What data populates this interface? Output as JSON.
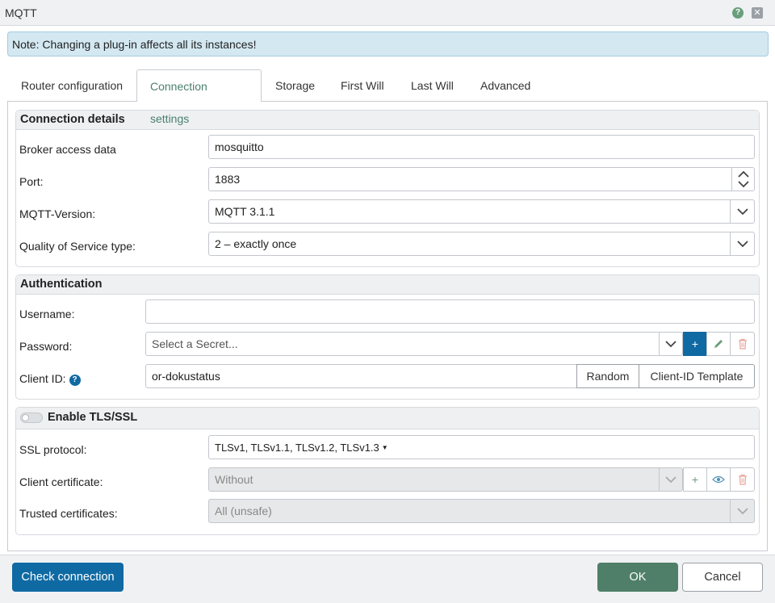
{
  "window": {
    "title": "MQTT",
    "help_icon": "question-icon",
    "close_icon": "close-icon"
  },
  "note": "Note: Changing a plug-in affects all its instances!",
  "tabs": [
    {
      "label": "Router configuration"
    },
    {
      "label": "Connection settings",
      "active": true
    },
    {
      "label": "Storage"
    },
    {
      "label": "First Will"
    },
    {
      "label": "Last Will"
    },
    {
      "label": "Advanced"
    }
  ],
  "connection": {
    "heading": "Connection details",
    "broker_label": "Broker access data",
    "broker_value": "mosquitto",
    "port_label": "Port:",
    "port_value": "1883",
    "version_label": "MQTT-Version:",
    "version_value": "MQTT 3.1.1",
    "qos_label": "Quality of Service type:",
    "qos_value": "2 – exactly once"
  },
  "auth": {
    "heading": "Authentication",
    "username_label": "Username:",
    "username_value": "",
    "password_label": "Password:",
    "password_placeholder": "Select a Secret...",
    "clientid_label": "Client ID:",
    "clientid_value": "or-dokustatus",
    "random_label": "Random",
    "template_label": "Client-ID Template"
  },
  "tls": {
    "heading": "Enable TLS/SSL",
    "enabled": false,
    "ssl_label": "SSL protocol:",
    "ssl_value": "TLSv1, TLSv1.1, TLSv1.2, TLSv1.3",
    "client_cert_label": "Client certificate:",
    "client_cert_value": "Without",
    "trusted_label": "Trusted certificates:",
    "trusted_value": "All (unsafe)"
  },
  "footer": {
    "check_label": "Check connection",
    "ok_label": "OK",
    "cancel_label": "Cancel"
  },
  "colors": {
    "primary": "#0f6aa3",
    "ok": "#4f7f68",
    "active_tab": "#4b7f6d",
    "delete": "#d9534f",
    "note_bg": "#d3e8f1"
  }
}
